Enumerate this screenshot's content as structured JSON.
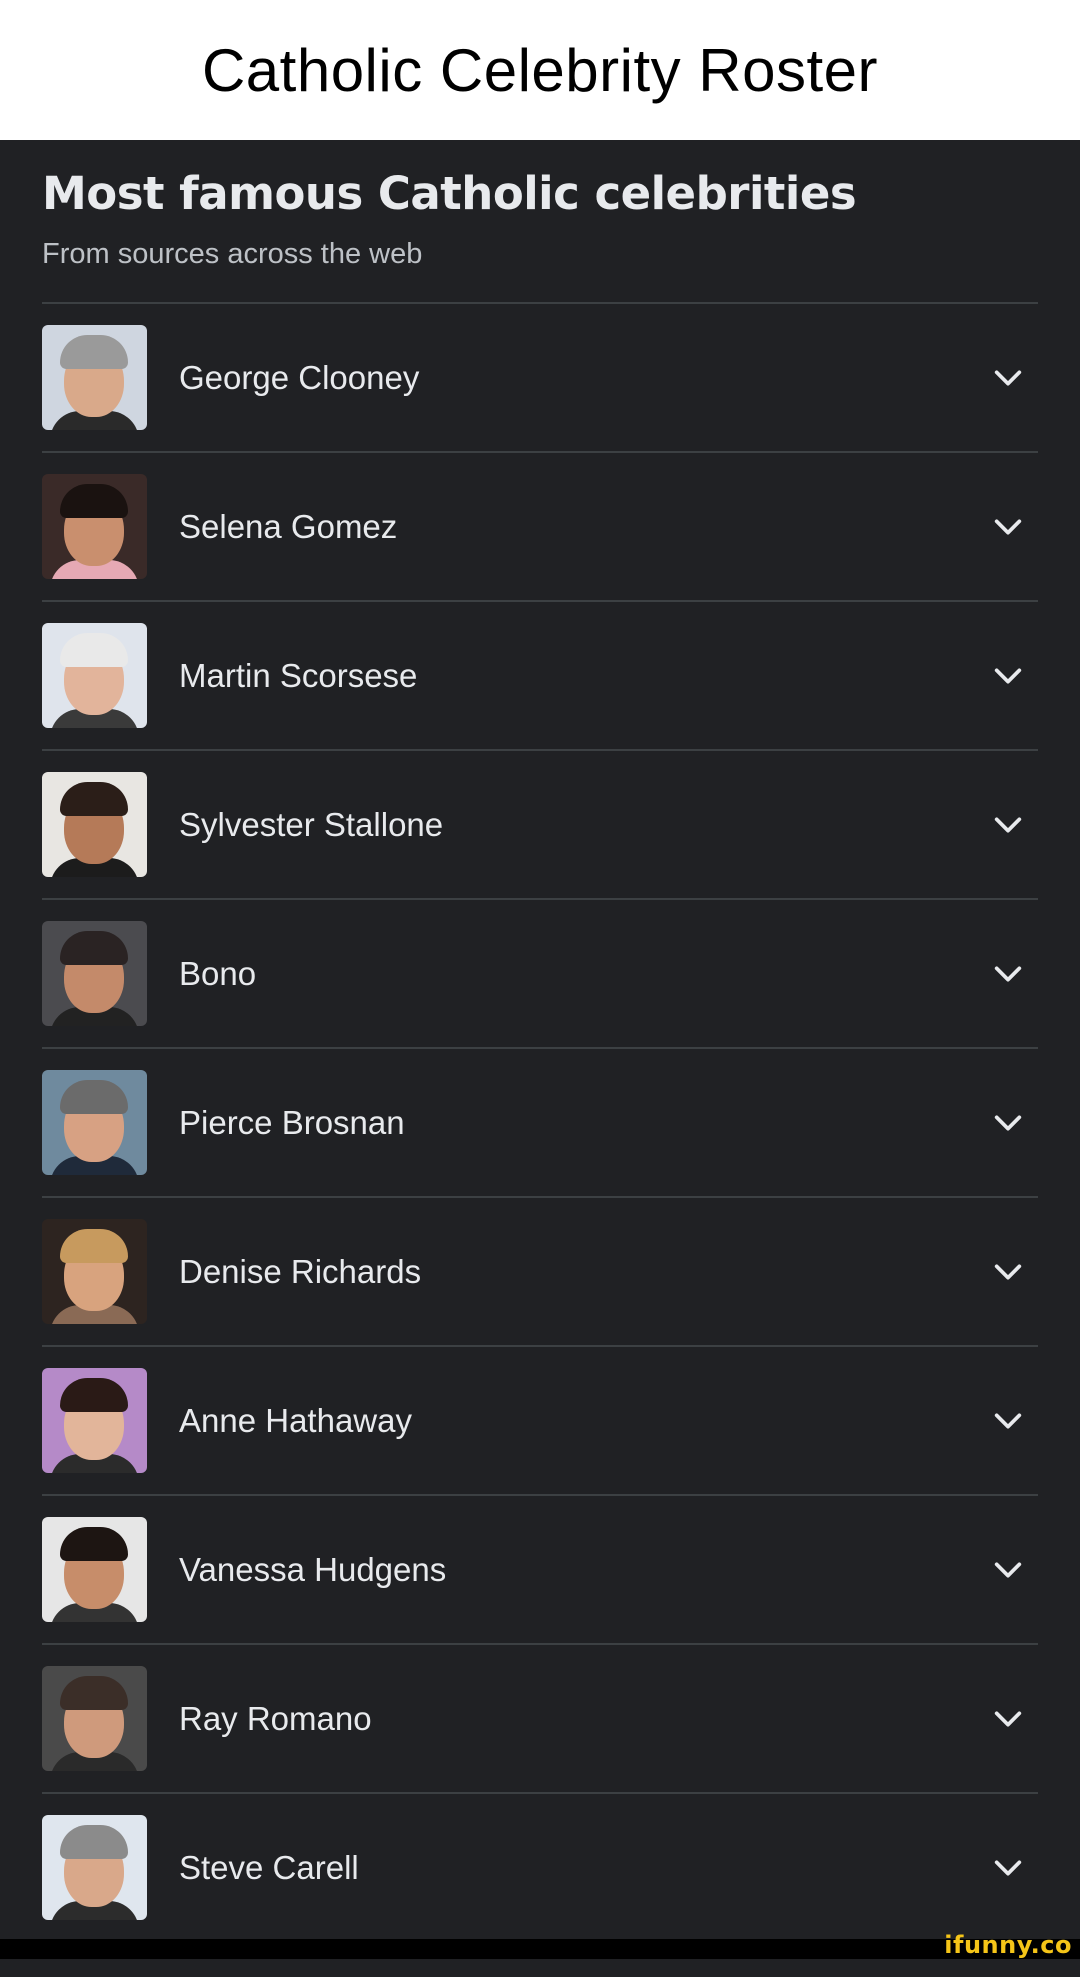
{
  "meme": {
    "title": "Catholic Celebrity Roster"
  },
  "panel": {
    "title": "Most famous Catholic celebrities",
    "subtitle": "From sources across the web"
  },
  "people": [
    {
      "name": "George Clooney",
      "bg": "#cfd6e0",
      "skin": "#d9a98a",
      "hair": "#9a9a9a",
      "body": "#2a2a2a"
    },
    {
      "name": "Selena Gomez",
      "bg": "#3a2a28",
      "skin": "#c98f6e",
      "hair": "#1a1210",
      "body": "#e6a9b4"
    },
    {
      "name": "Martin Scorsese",
      "bg": "#dfe4ec",
      "skin": "#e2b49b",
      "hair": "#e9e9e9",
      "body": "#3a3a3a"
    },
    {
      "name": "Sylvester Stallone",
      "bg": "#e8e6e2",
      "skin": "#b57a58",
      "hair": "#2b1e18",
      "body": "#1c1c1c"
    },
    {
      "name": "Bono",
      "bg": "#4b4b4f",
      "skin": "#c48a6a",
      "hair": "#2a2323",
      "body": "#222222"
    },
    {
      "name": "Pierce Brosnan",
      "bg": "#6f8a9e",
      "skin": "#d7a183",
      "hair": "#6b6b6b",
      "body": "#1f2a3a"
    },
    {
      "name": "Denise Richards",
      "bg": "#2d2420",
      "skin": "#d8a37e",
      "hair": "#c79a5e",
      "body": "#8a6a55"
    },
    {
      "name": "Anne Hathaway",
      "bg": "#b58ac8",
      "skin": "#e2b59a",
      "hair": "#2a1a16",
      "body": "#2b2b2b"
    },
    {
      "name": "Vanessa Hudgens",
      "bg": "#e6e6e6",
      "skin": "#c78d6a",
      "hair": "#1d1512",
      "body": "#333333"
    },
    {
      "name": "Ray Romano",
      "bg": "#4a4a4a",
      "skin": "#cf9a7c",
      "hair": "#3b2e28",
      "body": "#2a2a2a"
    },
    {
      "name": "Steve Carell",
      "bg": "#dfe6ee",
      "skin": "#d9a88a",
      "hair": "#8b8b8b",
      "body": "#2c2c2c"
    }
  ],
  "icons": {
    "expand": "chevron-down-icon"
  },
  "watermark": "ifunny.co"
}
